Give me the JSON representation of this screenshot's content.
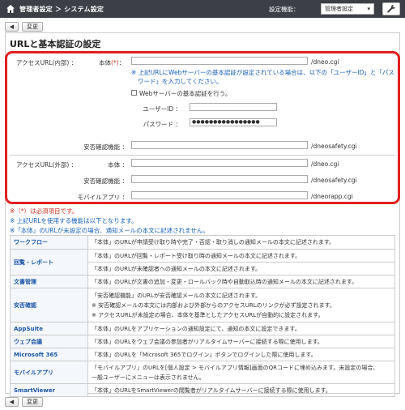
{
  "header": {
    "breadcrumb": "管理者設定 ＞ システム設定",
    "feature_label": "設定機能：",
    "feature_select": "管理者設定"
  },
  "toolbar": {
    "change_label": "変更"
  },
  "page_title": "URLと基本認証の設定",
  "internal": {
    "section_label": "アクセスURL(内部) ：",
    "body_label": "本体",
    "required_mark": "(*)",
    "colon": "：",
    "body_suffix": "/dneo.cgi",
    "note": "※ 上記URLにWebサーバーの基本認証が設定されている場合は、以下の「ユーザーID」と「パス",
    "note2": "ワード」を入力してください。",
    "auth_checkbox_label": "Webサーバーの基本認証を行う。",
    "userid_label": "ユーザーID ：",
    "password_label": "パスワード ：",
    "password_value": "●●●●●●●●●●●●●●●●",
    "safety_label": "安否確認機能 ：",
    "safety_suffix": "/dneosafety.cgi"
  },
  "external": {
    "section_label": "アクセスURL(外部) ：",
    "body_label": "本体 ：",
    "body_suffix": "/dneo.cgi",
    "safety_label": "安否確認機能 ：",
    "safety_suffix": "/dneosafety.cgi",
    "mobile_label": "モバイルアプリ ：",
    "mobile_suffix": "/dneorapp.cgi"
  },
  "notes": {
    "required": "※（*）は必須項目です。",
    "uses": "※ 上記URLを使用する機能は以下となります。",
    "unset": "※「本体」のURLが未設定の場合、通知メールの本文に記述されません。"
  },
  "features": [
    {
      "name": "ワークフロー",
      "lines": [
        "「本体」のURLが申請受け取り時や完了・否認・取り消しの通知メールの本文に記述されます。"
      ]
    },
    {
      "name": "回覧・レポート",
      "lines": [
        "「本体」のURLが回覧・レポート受け取り時の通知メールの本文に記述されます。"
      ]
    },
    {
      "name": "",
      "lines": [
        "「本体」のURLが未確認者への通知メールの本文に記述されます。"
      ]
    },
    {
      "name": "文書管理",
      "lines": [
        "「本体」のURLが文書の追加・変更・ロールバック時や自動取込時の通知メールの本文に記述されます。"
      ]
    },
    {
      "name": "安否確認",
      "lines": [
        "「安否確認機能」のURLが安否確認メールの本文に記述されます。",
        "※ 安否確認メールの本文には内部および外部からのアクセスURLのリンクが必ず設定されます。",
        "※ アクセスURLが未設定の場合、本体を基準としたアクセスURLが自動的に設定されます。"
      ]
    },
    {
      "name": "AppSuite",
      "lines": [
        "「本体」のURLをアプリケーションの通知設定にて、通知の本文に設定できます。"
      ]
    },
    {
      "name": "ウェブ会議",
      "lines": [
        "「本体」のURLをウェブ会議の参加者がリアルタイムサーバーに接続する際に使用します。"
      ]
    },
    {
      "name": "Microsoft 365",
      "lines": [
        "「本体」のURLを「Microsoft 365でログイン」ボタンでログインした際に使用します。"
      ]
    },
    {
      "name": "モバイルアプリ",
      "lines": [
        "「モバイルアプリ」のURLを[個人設定 > モバイルアプリ情報]画面のQRコードに埋め込みます。未設定の場合、",
        "一般ユーザーにメニューは表示されません。"
      ]
    },
    {
      "name": "SmartViewer",
      "lines": [
        "「本体」のURLをSmartViewerの閲覧者がリアルタイムサーバーに接続する際に使用します。"
      ]
    }
  ]
}
